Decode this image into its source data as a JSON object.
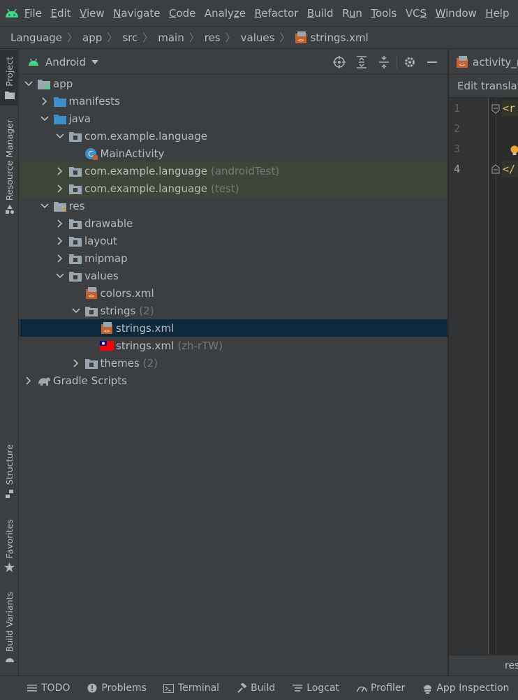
{
  "menu": {
    "items": [
      {
        "pre": "",
        "ul": "F",
        "post": "ile"
      },
      {
        "pre": "",
        "ul": "E",
        "post": "dit"
      },
      {
        "pre": "",
        "ul": "V",
        "post": "iew"
      },
      {
        "pre": "",
        "ul": "N",
        "post": "avigate"
      },
      {
        "pre": "",
        "ul": "C",
        "post": "ode"
      },
      {
        "pre": "Analy",
        "ul": "z",
        "post": "e"
      },
      {
        "pre": "",
        "ul": "R",
        "post": "efactor"
      },
      {
        "pre": "",
        "ul": "B",
        "post": "uild"
      },
      {
        "pre": "R",
        "ul": "u",
        "post": "n"
      },
      {
        "pre": "",
        "ul": "T",
        "post": "ools"
      },
      {
        "pre": "VC",
        "ul": "S",
        "post": ""
      },
      {
        "pre": "",
        "ul": "W",
        "post": "indow"
      },
      {
        "pre": "",
        "ul": "H",
        "post": "elp"
      }
    ]
  },
  "breadcrumb": [
    "Language",
    "app",
    "src",
    "main",
    "res",
    "values",
    "strings.xml"
  ],
  "left_tabs": [
    "Project",
    "Resource Manager",
    "Structure",
    "Favorites",
    "Build Variants"
  ],
  "project": {
    "view": "Android",
    "tree": [
      {
        "label": "app",
        "hint": "",
        "depth": 0,
        "chevron": "down",
        "icon": "module-folder-icon"
      },
      {
        "label": "manifests",
        "hint": "",
        "depth": 1,
        "chevron": "right",
        "icon": "folder-icon"
      },
      {
        "label": "java",
        "hint": "",
        "depth": 1,
        "chevron": "down",
        "icon": "folder-icon"
      },
      {
        "label": "com.example.language",
        "hint": "",
        "depth": 2,
        "chevron": "down",
        "icon": "package-icon"
      },
      {
        "label": "MainActivity",
        "hint": "",
        "depth": 3,
        "chevron": "none",
        "icon": "kotlin-class-icon"
      },
      {
        "label": "com.example.language",
        "hint": "(androidTest)",
        "depth": 2,
        "chevron": "right",
        "icon": "package-icon",
        "test": true
      },
      {
        "label": "com.example.language",
        "hint": "(test)",
        "depth": 2,
        "chevron": "right",
        "icon": "package-icon",
        "test": true
      },
      {
        "label": "res",
        "hint": "",
        "depth": 1,
        "chevron": "down",
        "icon": "res-folder-icon"
      },
      {
        "label": "drawable",
        "hint": "",
        "depth": 2,
        "chevron": "right",
        "icon": "package-icon"
      },
      {
        "label": "layout",
        "hint": "",
        "depth": 2,
        "chevron": "right",
        "icon": "package-icon"
      },
      {
        "label": "mipmap",
        "hint": "",
        "depth": 2,
        "chevron": "right",
        "icon": "package-icon"
      },
      {
        "label": "values",
        "hint": "",
        "depth": 2,
        "chevron": "down",
        "icon": "package-icon"
      },
      {
        "label": "colors.xml",
        "hint": "",
        "depth": 3,
        "chevron": "none",
        "icon": "xml-file-icon"
      },
      {
        "label": "strings",
        "hint": "(2)",
        "depth": 3,
        "chevron": "down",
        "icon": "package-icon"
      },
      {
        "label": "strings.xml",
        "hint": "",
        "depth": 4,
        "chevron": "none",
        "icon": "xml-file-icon",
        "selected": true
      },
      {
        "label": "strings.xml",
        "hint": "(zh-rTW)",
        "depth": 4,
        "chevron": "none",
        "icon": "taiwan-flag-icon"
      },
      {
        "label": "themes",
        "hint": "(2)",
        "depth": 3,
        "chevron": "right",
        "icon": "package-icon"
      },
      {
        "label": "Gradle Scripts",
        "hint": "",
        "depth": 0,
        "chevron": "right",
        "icon": "gradle-elephant-icon"
      }
    ]
  },
  "editor": {
    "tab": "activity_main.xml",
    "banner": "Edit translations for all locales in the translations editor.",
    "line_numbers": [
      "1",
      "2",
      "3",
      "4"
    ],
    "lines": [
      "<r",
      "",
      "",
      "</"
    ],
    "status": "resources"
  },
  "bottom_tools": [
    {
      "label": "TODO",
      "icon": "list-icon"
    },
    {
      "label": "Problems",
      "icon": "info-circle-icon"
    },
    {
      "label": "Terminal",
      "icon": "terminal-icon"
    },
    {
      "label": "Build",
      "icon": "hammer-icon"
    },
    {
      "label": "Logcat",
      "icon": "logcat-icon"
    },
    {
      "label": "Profiler",
      "icon": "gauge-icon"
    },
    {
      "label": "App Inspection",
      "icon": "app-inspection-icon"
    }
  ],
  "colors": {
    "android_green": "#3ddc84",
    "folder_blue": "#3d8fc7",
    "selection": "#0d293e",
    "test_bg": "#3e4539",
    "xml_orange": "#c5622a"
  }
}
